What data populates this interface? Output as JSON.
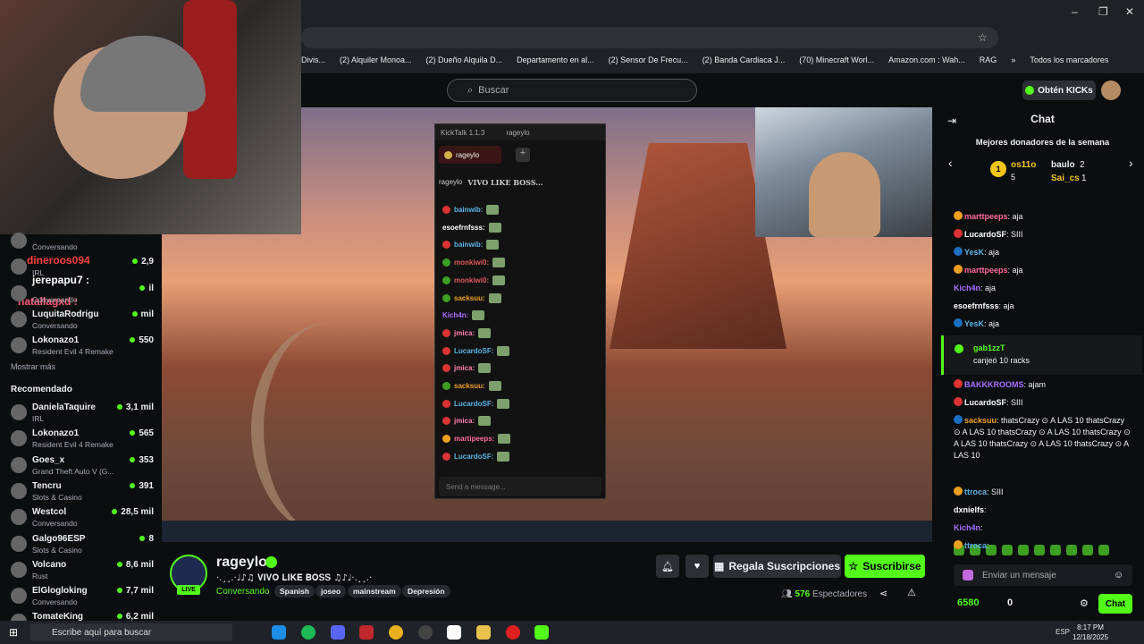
{
  "browser": {
    "bookmarks": [
      "Divis...",
      "(2) Alquiler Monoa...",
      "(2) Dueño Alquila D...",
      "Departamento en al...",
      "(2) Sensor De Frecu...",
      "(2) Banda Cardiaca J...",
      "(70) Minecraft Worl...",
      "Amazon.com : Wah...",
      "RAG",
      "»",
      "Todos los marcadores"
    ]
  },
  "header": {
    "search_placeholder": "Buscar",
    "kicks_label": "Obtén KICKs"
  },
  "sidebar": {
    "overlay_names": [
      "jerepapu7 :",
      "natallagxd :",
      "dineroos094"
    ],
    "following": [
      {
        "name": "",
        "sub": "Conversando",
        "viewers": ""
      },
      {
        "name": "",
        "sub": "IRL",
        "viewers": "2,9"
      },
      {
        "name": "",
        "sub": "Conversando",
        "viewers": "il"
      },
      {
        "name": "LuquitaRodrigu",
        "sub": "Conversando",
        "viewers": "mil"
      },
      {
        "name": "Lokonazo1",
        "sub": "Resident Evil 4 Remake",
        "viewers": "550"
      }
    ],
    "show_more": "Mostrar más",
    "recommended_title": "Recomendado",
    "recommended": [
      {
        "name": "DanielaTaquire",
        "sub": "IRL",
        "viewers": "3,1 mil"
      },
      {
        "name": "Lokonazo1",
        "sub": "Resident Evil 4 Remake",
        "viewers": "565"
      },
      {
        "name": "Goes_x",
        "sub": "Grand Theft Auto V (G...",
        "viewers": "353"
      },
      {
        "name": "Tencru",
        "sub": "Slots & Casino",
        "viewers": "391"
      },
      {
        "name": "Westcol",
        "sub": "Conversando",
        "viewers": "28,5 mil"
      },
      {
        "name": "Galgo96ESP",
        "sub": "Slots & Casino",
        "viewers": "8"
      },
      {
        "name": "Volcano",
        "sub": "Rust",
        "viewers": "8,6 mil"
      },
      {
        "name": "ElGlogloking",
        "sub": "Conversando",
        "viewers": "7,7 mil"
      },
      {
        "name": "TomateKing",
        "sub": "",
        "viewers": "6,2 mil"
      }
    ]
  },
  "kicktalk": {
    "title": "KickTalk 1.1.3",
    "window_user": "rageylo",
    "tab": "rageylo",
    "channel": "rageylo",
    "channel_title": "VIVO LIKE BOSS...",
    "messages": [
      {
        "user": "bainwib:",
        "color": "#5bb4e8",
        "dot": "#d33"
      },
      {
        "user": "esoefrnfsss:",
        "color": "#ffffff",
        "dot": ""
      },
      {
        "user": "bainwib:",
        "color": "#5bb4e8",
        "dot": "#d33"
      },
      {
        "user": "monkiwi0:",
        "color": "#e05a5a",
        "dot": "#3da022"
      },
      {
        "user": "monkiwi0:",
        "color": "#e05a5a",
        "dot": "#3da022"
      },
      {
        "user": "sacksuu:",
        "color": "#f0a020",
        "dot": "#3da022"
      },
      {
        "user": "Kich4n:",
        "color": "#a970ff",
        "dot": ""
      },
      {
        "user": "jmica:",
        "color": "#ff7fb0",
        "dot": "#d33"
      },
      {
        "user": "LucardoSF:",
        "color": "#5bb4e8",
        "dot": "#d33"
      },
      {
        "user": "jmica:",
        "color": "#ff7fb0",
        "dot": "#d33"
      },
      {
        "user": "sacksuu:",
        "color": "#f0a020",
        "dot": "#3da022"
      },
      {
        "user": "LucardoSF:",
        "color": "#5bb4e8",
        "dot": "#d33"
      },
      {
        "user": "jmica:",
        "color": "#ff7fb0",
        "dot": "#d33"
      },
      {
        "user": "martipeeps:",
        "color": "#ff6aa0",
        "dot": "#f0a020"
      },
      {
        "user": "LucardoSF:",
        "color": "#5bb4e8",
        "dot": "#d33"
      }
    ],
    "input_placeholder": "Send a message..."
  },
  "channel": {
    "name": "rageylo",
    "live": "LIVE",
    "title": "·.¸¸.·♩♪♫ 𝐕𝐈𝐕𝐎 𝐋𝐈𝐊𝐄 𝐁𝐎𝐒𝐒 ♫♪♩·.¸¸.·",
    "category": "Conversando",
    "tags": [
      "Spanish",
      "joseo",
      "mainstream",
      "Depresión"
    ],
    "gift_label": "Regala Suscripciones",
    "subscribe_label": "Suscribirse",
    "viewers": "576",
    "viewers_label": "Espectadores"
  },
  "chat": {
    "title": "Chat",
    "donors_title": "Mejores donadores de la semana",
    "donors": [
      {
        "name": "os11o",
        "amount": "5",
        "rank": "1"
      },
      {
        "name": "baulo",
        "amount": "2"
      },
      {
        "name": "Sai_cs",
        "amount": "1"
      }
    ],
    "messages": [
      {
        "user": "marttpeeps",
        "color": "#ff6aa0",
        "text": ": aja",
        "badge": "#f0a020"
      },
      {
        "user": "LucardoSF",
        "color": "#ffffff",
        "text": ": SIII",
        "badge": "#d33"
      },
      {
        "user": "YesK",
        "color": "#5bb4e8",
        "text": ": aja",
        "badge": "#1c6fc2"
      },
      {
        "user": "marttpeeps",
        "color": "#ff6aa0",
        "text": ": aja",
        "badge": "#f0a020"
      },
      {
        "user": "Kich4n",
        "color": "#a970ff",
        "text": ": aja",
        "badge": ""
      },
      {
        "user": "esoefrnfsss",
        "color": "#ffffff",
        "text": ": aja",
        "badge": ""
      },
      {
        "user": "YesK",
        "color": "#5bb4e8",
        "text": ": aja",
        "badge": "#1c6fc2"
      }
    ],
    "redeem_user": "gab1zzT",
    "redeem_text": "canjeó 10 racks",
    "messages2": [
      {
        "user": "BAKKKROOMS",
        "color": "#a970ff",
        "text": ": ajam",
        "badge": "#d33"
      },
      {
        "user": "LucardoSF",
        "color": "#ffffff",
        "text": ": SIII",
        "badge": "#d33"
      },
      {
        "user": "sacksuu",
        "color": "#f0a020",
        "text": ": thatsCrazy ⊙ A LAS 10 thatsCrazy ⊙ A LAS 10 thatsCrazy ⊙ A LAS 10 thatsCrazy ⊙ A LAS 10 thatsCrazy ⊙ A LAS 10 thatsCrazy ⊙ A LAS 10",
        "badge": "#1c6fc2"
      },
      {
        "user": "ttroca",
        "color": "#5bb4e8",
        "text": ": SIII",
        "badge": "#f0a020"
      },
      {
        "user": "dxnielfs",
        "color": "#ffffff",
        "text": ":",
        "badge": ""
      },
      {
        "user": "Kich4n",
        "color": "#a970ff",
        "text": ":",
        "badge": ""
      },
      {
        "user": "ttroca",
        "color": "#5bb4e8",
        "text": ":",
        "badge": "#f0a020"
      }
    ],
    "input_placeholder": "Enviar un mensaje",
    "points": "6580",
    "slots": "0",
    "chat_button": "Chat"
  },
  "taskbar": {
    "search_placeholder": "Escribe aquí para buscar",
    "lang": "ESP",
    "time": "8:17 PM",
    "date": "12/18/2025"
  },
  "colors": {
    "accent": "#53fc18",
    "bg": "#0b0e0f"
  }
}
